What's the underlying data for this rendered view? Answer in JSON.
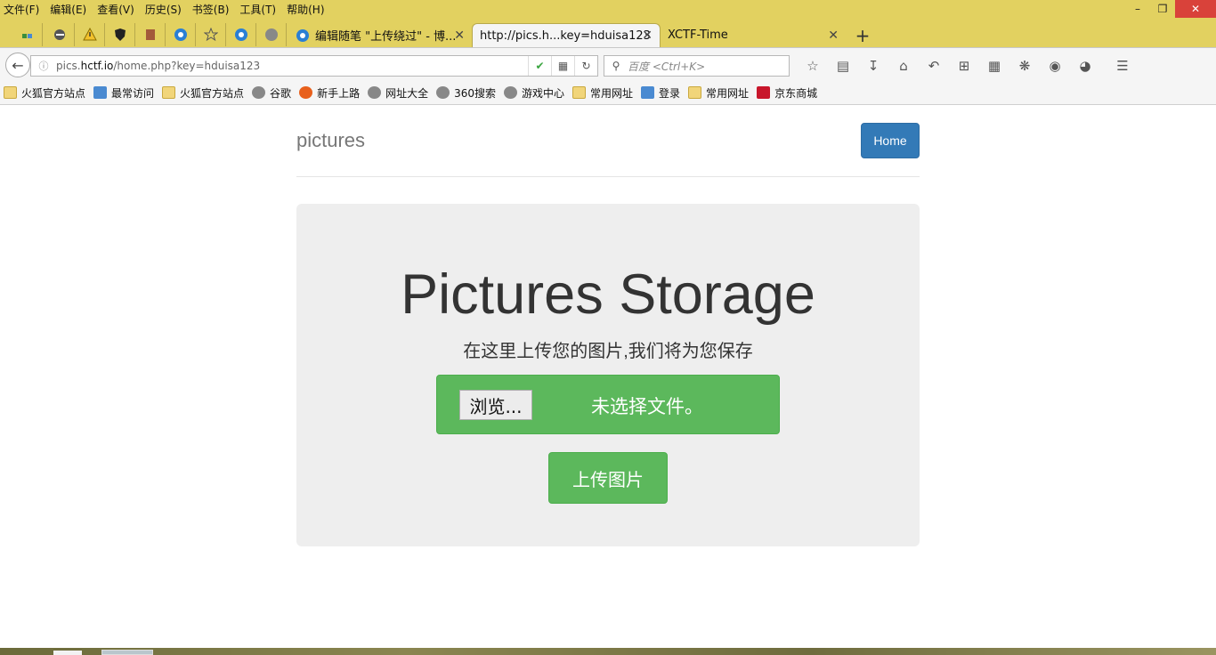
{
  "menu": [
    "文件(F)",
    "编辑(E)",
    "查看(V)",
    "历史(S)",
    "书签(B)",
    "工具(T)",
    "帮助(H)"
  ],
  "window_controls": {
    "minimize": "–",
    "restore": "❐",
    "close": "✕"
  },
  "tabs": [
    {
      "label": "编辑随笔 \"上传绕过\" - 博...",
      "active": false
    },
    {
      "label": "http://pics.h...key=hduisa123",
      "active": true
    },
    {
      "label": "XCTF-Time",
      "active": false
    }
  ],
  "tab_close": "✕",
  "new_tab": "+",
  "address": {
    "prefix": "pics.",
    "host": "hctf.io",
    "path": "/home.php?key=hduisa123"
  },
  "search": {
    "placeholder": "百度 <Ctrl+K>"
  },
  "bookmarks": [
    {
      "label": "火狐官方站点",
      "icon": "folder"
    },
    {
      "label": "最常访问",
      "icon": "blue"
    },
    {
      "label": "火狐官方站点",
      "icon": "folder"
    },
    {
      "label": "谷歌",
      "icon": "globe"
    },
    {
      "label": "新手上路",
      "icon": "fox"
    },
    {
      "label": "网址大全",
      "icon": "globe"
    },
    {
      "label": "360搜索",
      "icon": "globe"
    },
    {
      "label": "游戏中心",
      "icon": "globe"
    },
    {
      "label": "常用网址",
      "icon": "folder"
    },
    {
      "label": "登录",
      "icon": "blue"
    },
    {
      "label": "常用网址",
      "icon": "folder"
    },
    {
      "label": "京东商城",
      "icon": "jd"
    }
  ],
  "site": {
    "brand": "pictures",
    "home_button": "Home",
    "title": "Pictures Storage",
    "subtitle": "在这里上传您的图片,我们将为您保存",
    "browse_button": "浏览...",
    "file_status": "未选择文件。",
    "upload_button": "上传图片"
  },
  "colors": {
    "chrome": "#e2d160",
    "primary": "#337ab7",
    "success": "#5cb85c",
    "jumbotron": "#eeeeee"
  }
}
